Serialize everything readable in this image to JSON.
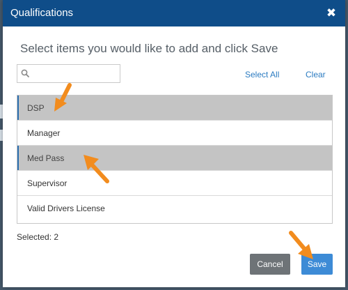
{
  "modal": {
    "title": "Qualifications",
    "close_symbol": "✖",
    "instructions": "Select items you would like to add and click Save",
    "search": {
      "value": "",
      "placeholder": ""
    },
    "select_all_label": "Select All",
    "clear_label": "Clear",
    "items": [
      {
        "label": "DSP",
        "selected": true
      },
      {
        "label": "Manager",
        "selected": false
      },
      {
        "label": "Med Pass",
        "selected": true
      },
      {
        "label": "Supervisor",
        "selected": false
      },
      {
        "label": "Valid Drivers License",
        "selected": false
      }
    ],
    "selected_text": "Selected: 2",
    "cancel_label": "Cancel",
    "save_label": "Save"
  },
  "colors": {
    "header": "#0f4d89",
    "selected_row": "#c4c4c4",
    "link": "#2b7bc1",
    "save_button": "#3d8bd6",
    "cancel_button": "#6e7377",
    "annotation_arrow": "#f28c1e"
  },
  "icons": {
    "search": "search-icon",
    "close": "close-icon",
    "arrow": "arrow-annotation-icon"
  }
}
